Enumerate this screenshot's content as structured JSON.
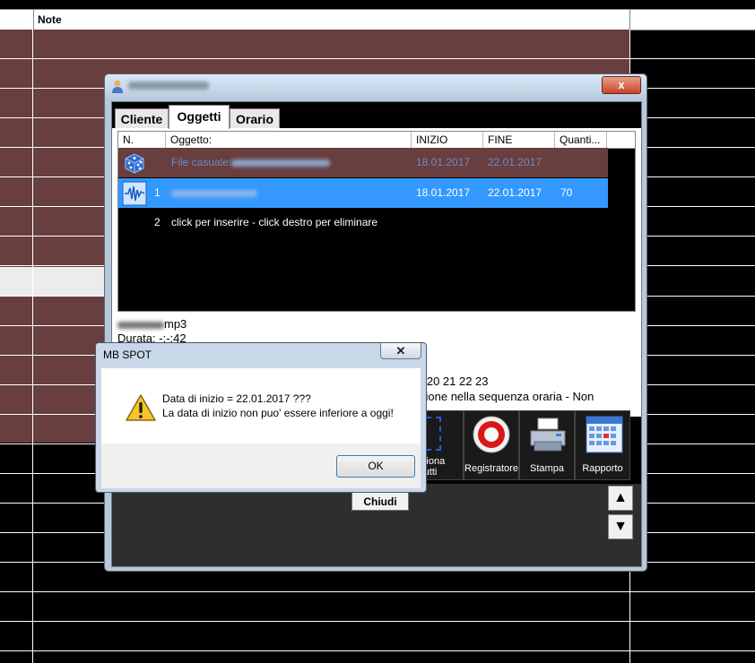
{
  "background_table": {
    "header_note": "Note"
  },
  "window": {
    "title_redacted": "",
    "close_label": "x",
    "tabs": [
      {
        "label": "Cliente",
        "active": false
      },
      {
        "label": "Oggetti",
        "active": true
      },
      {
        "label": "Orario",
        "active": false
      }
    ],
    "list": {
      "columns": [
        "N.",
        "Oggetto:",
        "INIZIO",
        "FINE",
        "Quanti..."
      ],
      "rows": [
        {
          "n": "",
          "object": "File casuale:",
          "start": "18.01.2017",
          "end": "22.01.2017",
          "qty": "",
          "icon": "dice-icon",
          "selected": false
        },
        {
          "n": "1",
          "object": "",
          "start": "18.01.2017",
          "end": "22.01.2017",
          "qty": "70",
          "icon": "audio-file-icon",
          "selected": true
        },
        {
          "n": "2",
          "object": "click per inserire - click destro per eliminare",
          "start": "",
          "end": "",
          "qty": "",
          "icon": "",
          "selected": false
        }
      ]
    },
    "info": {
      "filename_suffix": "mp3",
      "duration_label": "Durata:",
      "duration_value": "-:-:42",
      "hours": "0 20 21 22 23",
      "sequence_text": "zione nella sequenza oraria - Non"
    },
    "toolbar": [
      {
        "label": "eziona\nutti",
        "icon": "select-all-icon"
      },
      {
        "label": "Registratore",
        "icon": "record-icon"
      },
      {
        "label": "Stampa",
        "icon": "printer-icon"
      },
      {
        "label": "Rapporto",
        "icon": "calendar-report-icon"
      }
    ],
    "close_button": "Chiudi",
    "scroll_up": "▲",
    "scroll_down": "▼"
  },
  "dialog": {
    "title": "MB SPOT",
    "close_label": "✕",
    "line1": "Data di inizio = 22.01.2017 ???",
    "line2": "La data di inizio non puo' essere inferiore a oggi!",
    "ok_label": "OK"
  },
  "colors": {
    "maroon_row": "#683e3e",
    "selected_row": "#3399ff",
    "muted_text": "#6a8cc8"
  }
}
